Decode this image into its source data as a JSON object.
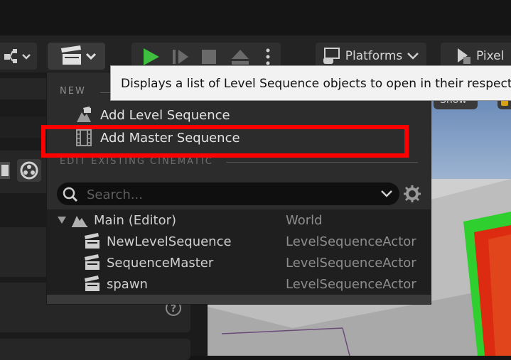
{
  "tooltip": "Displays a list of Level Sequence objects to open in their respective ed",
  "toolbar": {
    "platforms_label": "Platforms",
    "pixel_label": "Pixel"
  },
  "menu": {
    "new_header": "NEW",
    "items": [
      {
        "label": "Add Level Sequence",
        "icon": "level-sequence-icon"
      },
      {
        "label": "Add Master Sequence",
        "icon": "film-strip-icon"
      }
    ],
    "edit_header": "EDIT EXISTING CINEMATIC",
    "search_placeholder": "Search...",
    "tree": [
      {
        "name": "Main (Editor)",
        "type": "World",
        "icon": "map-icon",
        "expanded": true
      },
      {
        "name": "NewLevelSequence",
        "type": "LevelSequenceActor",
        "icon": "clapperboard-icon"
      },
      {
        "name": "SequenceMaster",
        "type": "LevelSequenceActor",
        "icon": "clapperboard-icon"
      },
      {
        "name": "spawn",
        "type": "LevelSequenceActor",
        "icon": "clapperboard-icon"
      }
    ]
  },
  "viewport": {
    "show_label": "Show"
  },
  "colors": {
    "highlight": "#ff0000",
    "play_green": "#3fbf3f"
  }
}
